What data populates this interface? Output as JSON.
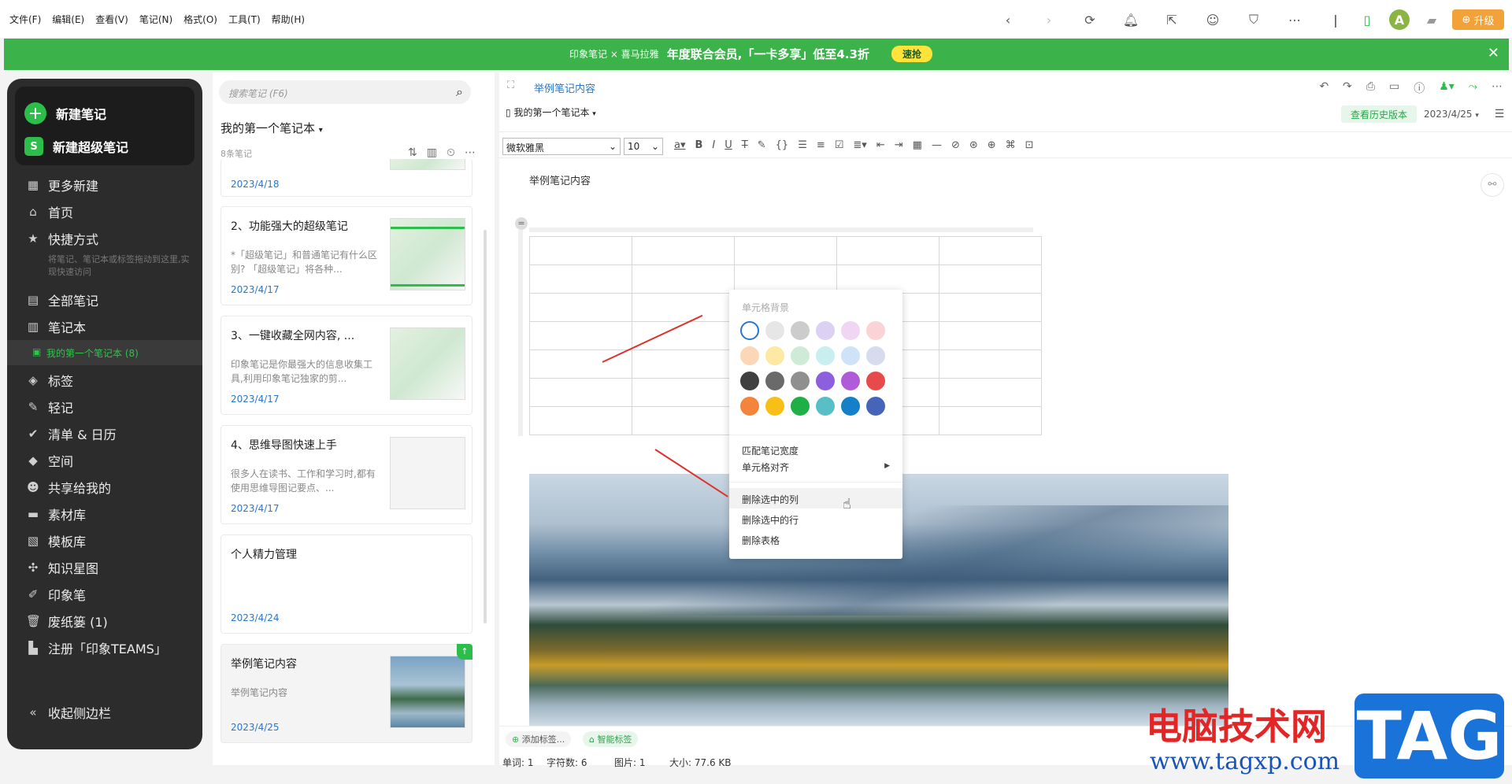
{
  "menu": [
    "文件(F)",
    "编辑(E)",
    "查看(V)",
    "笔记(N)",
    "格式(O)",
    "工具(T)",
    "帮助(H)"
  ],
  "toolbar_icons": [
    "back-icon",
    "forward-icon",
    "sync-icon",
    "bell-icon",
    "share-exit-icon",
    "smile-icon",
    "shield-icon",
    "more-circle-icon",
    "phone-icon",
    "avatar",
    "book-icon"
  ],
  "avatar_letter": "A",
  "upgrade_label": "升级",
  "banner": {
    "logo_text": "印象笔记 × 喜马拉雅",
    "text": "年度联合会员,「一卡多享」低至4.3折",
    "button": "速抢",
    "close": "✕"
  },
  "sidebar": {
    "new_note": "新建笔记",
    "new_super_note": "新建超级笔记",
    "items": [
      {
        "icon": "grid-icon",
        "label": "更多新建"
      },
      {
        "icon": "home-icon",
        "label": "首页"
      },
      {
        "icon": "star-icon",
        "label": "快捷方式"
      },
      {
        "icon": "notes-icon",
        "label": "全部笔记"
      },
      {
        "icon": "notebook-icon",
        "label": "笔记本"
      },
      {
        "icon": "tag-icon",
        "label": "标签"
      },
      {
        "icon": "feather-icon",
        "label": "轻记"
      },
      {
        "icon": "check-icon",
        "label": "清单 & 日历"
      },
      {
        "icon": "cube-icon",
        "label": "空间"
      },
      {
        "icon": "people-icon",
        "label": "共享给我的"
      },
      {
        "icon": "box-icon",
        "label": "素材库"
      },
      {
        "icon": "template-icon",
        "label": "模板库"
      },
      {
        "icon": "graph-icon",
        "label": "知识星图"
      },
      {
        "icon": "pen-icon",
        "label": "印象笔"
      },
      {
        "icon": "trash-icon",
        "label": "废纸篓 (1)"
      },
      {
        "icon": "building-icon",
        "label": "注册「印象TEAMS」"
      }
    ],
    "shortcut_hint": "将笔记、笔记本或标签拖动到这里,实现快速访问",
    "active_notebook": "我的第一个笔记本 (8)",
    "collapse": "收起侧边栏"
  },
  "notelist": {
    "search_placeholder": "搜索笔记 (F6)",
    "notebook": "我的第一个笔记本",
    "count": "8条笔记",
    "top_date": "2023/4/18",
    "cards": [
      {
        "title": "2、功能强大的超级笔记",
        "snippet": "*「超级笔记」和普通笔记有什么区别? 「超级笔记」将各种...",
        "date": "2023/4/17"
      },
      {
        "title": "3、一键收藏全网内容, ...",
        "snippet": "印象笔记是你最强大的信息收集工具,利用印象笔记独家的剪...",
        "date": "2023/4/17"
      },
      {
        "title": "4、思维导图快速上手",
        "snippet": "很多人在读书、工作和学习时,都有使用思维导图记要点、...",
        "date": "2023/4/17"
      },
      {
        "title": "个人精力管理",
        "snippet": "",
        "date": "2023/4/24"
      },
      {
        "title": "举例笔记内容",
        "snippet": "举例笔记内容",
        "date": "2023/4/25"
      }
    ]
  },
  "editor": {
    "title": "举例笔记内容",
    "notebook": "我的第一个笔记本",
    "history_btn": "查看历史版本",
    "date": "2023/4/25",
    "font": "微软雅黑",
    "size": "10",
    "note_text": "举例笔记内容",
    "add_tag": "添加标签...",
    "smart_tag": "智能标签",
    "status": {
      "words": "单词: 1",
      "chars": "字符数: 6",
      "images": "图片: 1",
      "size": "大小: 77.6 KB"
    }
  },
  "context_menu": {
    "header": "单元格背景",
    "colors": [
      "#ffffff",
      "#e6e6e6",
      "#cccccc",
      "#dcd0f3",
      "#f0d6f3",
      "#f9d3d6",
      "#fbd7b8",
      "#fde8a4",
      "#cdebd6",
      "#c9eef0",
      "#cfe3f8",
      "#d6dcee",
      "#404040",
      "#6a6a6a",
      "#8f8f8f",
      "#8d5fdc",
      "#b05cd8",
      "#e64a4a",
      "#f4833b",
      "#f8c016",
      "#1eb046",
      "#58bfc6",
      "#1480c8",
      "#4566b8"
    ],
    "items": [
      "匹配笔记宽度",
      "单元格对齐",
      "删除选中的列",
      "删除选中的行",
      "删除表格"
    ]
  },
  "watermark": {
    "cn": "电脑技术网",
    "url": "www.tagxp.com",
    "tag": "TAG"
  }
}
